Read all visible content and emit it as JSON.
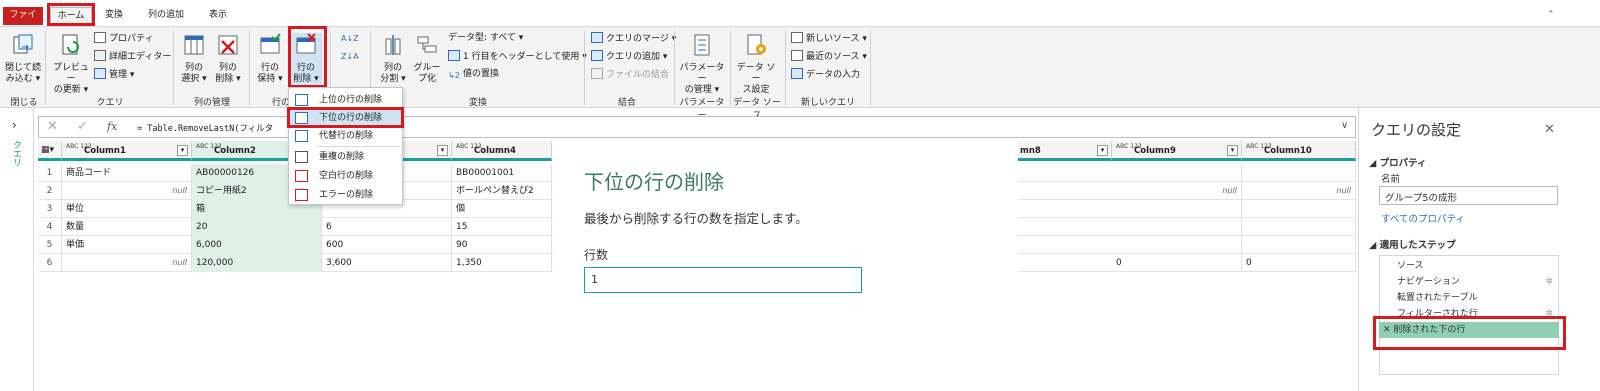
{
  "tabs": {
    "file": "ファイル",
    "home": "ホーム",
    "transform": "変換",
    "add_column": "列の追加",
    "view": "表示"
  },
  "ribbon": {
    "close": {
      "label1": "閉じて読",
      "label2": "み込む",
      "group": "閉じる"
    },
    "query": {
      "preview1": "プレビュー",
      "preview2": "の更新",
      "properties": "プロパティ",
      "advanced_editor": "詳細エディター",
      "manage": "管理",
      "group": "クエリ"
    },
    "manage_columns": {
      "choose1": "列の",
      "choose2": "選択",
      "remove1": "列の",
      "remove2": "削除",
      "group": "列の管理"
    },
    "reduce_rows": {
      "keep1": "行の",
      "keep2": "保持",
      "remove1": "行の",
      "remove2": "削除",
      "group": "行の"
    },
    "sort": {
      "asc": "A↓Z",
      "desc": "Z↓A"
    },
    "transform": {
      "split1": "列の",
      "split2": "分割",
      "group1": "グルー",
      "group2": "プ化",
      "data_type": "データ型: すべて",
      "first_row_header": "1 行目をヘッダーとして使用",
      "replace_values": "値の置換",
      "group": "変換"
    },
    "combine": {
      "merge": "クエリのマージ",
      "append": "クエリの追加",
      "combine_files": "ファイルの結合",
      "group": "結合"
    },
    "parameters": {
      "label1": "パラメーター",
      "label2": "の管理",
      "group": "パラメーター"
    },
    "data_source": {
      "label1": "データ ソー",
      "label2": "ス設定",
      "group": "データ ソース"
    },
    "new_query": {
      "new_source": "新しいソース",
      "recent_sources": "最近のソース",
      "enter_data": "データの入力",
      "group": "新しいクエリ"
    }
  },
  "left_panel": {
    "label": "クエリ"
  },
  "formula": {
    "text": "= Table.RemoveLastN(フィルタ"
  },
  "grid": {
    "headers": [
      {
        "type": "ABC 123",
        "name": "Column1"
      },
      {
        "type": "ABC 123",
        "name": "Column2"
      },
      {
        "type": "ABC 123",
        "name": "Column3"
      },
      {
        "type": "ABC 123",
        "name": "Column4"
      },
      {
        "type": "",
        "name": "mn8"
      },
      {
        "type": "ABC 123",
        "name": "Column9"
      },
      {
        "type": "ABC 123",
        "name": "Column10"
      }
    ],
    "rows": [
      {
        "n": "1",
        "c1": "商品コード",
        "c2": "AB00000126",
        "c3": "",
        "c4": "BB00001001",
        "c9": "",
        "c10": ""
      },
      {
        "n": "2",
        "c1": "null",
        "c2": "コピー用紙2",
        "c3": "",
        "c4": "ボールペン替えぴ2",
        "c9": "null",
        "c10": "null"
      },
      {
        "n": "3",
        "c1": "単位",
        "c2": "箱",
        "c3": "",
        "c4": "個",
        "c9": "",
        "c10": ""
      },
      {
        "n": "4",
        "c1": "数量",
        "c2": "20",
        "c3": "6",
        "c4": "15",
        "c9": "",
        "c10": ""
      },
      {
        "n": "5",
        "c1": "単価",
        "c2": "6,000",
        "c3": "600",
        "c4": "90",
        "c9": "",
        "c10": ""
      },
      {
        "n": "6",
        "c1": "null",
        "c2": "120,000",
        "c3": "3,600",
        "c4": "1,350",
        "c9": "0",
        "c10": "0"
      }
    ]
  },
  "menu": {
    "items": [
      "上位の行の削除",
      "下位の行の削除",
      "代替行の削除",
      "重複の削除",
      "空白行の削除",
      "エラーの削除"
    ]
  },
  "dialog": {
    "title": "下位の行の削除",
    "description": "最後から削除する行の数を指定します。",
    "field_label": "行数",
    "field_value": "1"
  },
  "settings": {
    "title": "クエリの設定",
    "properties_header": "プロパティ",
    "name_label": "名前",
    "name_value": "グループ5の成形",
    "all_properties": "すべてのプロパティ",
    "steps_header": "適用したステップ",
    "steps": [
      "ソース",
      "ナビゲーション",
      "転置されたテーブル",
      "フィルターされた行",
      "削除された下の行"
    ]
  },
  "colors": {
    "accent": "#15a39a",
    "file_tab": "#c8201e",
    "highlight": "#d8191f",
    "dialog_title": "#3d7a62"
  }
}
